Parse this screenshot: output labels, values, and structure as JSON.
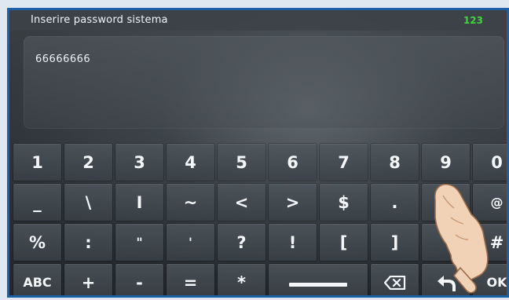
{
  "header": {
    "title": "Inserire password sistema",
    "mode_badge": "123"
  },
  "input": {
    "value": "66666666"
  },
  "keyboard": {
    "row1": [
      "1",
      "2",
      "3",
      "4",
      "5",
      "6",
      "7",
      "8",
      "9",
      "0"
    ],
    "row2": [
      "_",
      "\\",
      "I",
      "~",
      "<",
      ">",
      "$",
      ".",
      "",
      "@"
    ],
    "row3": [
      "%",
      ":",
      "\"",
      "'",
      "?",
      "!",
      "[",
      "]",
      "",
      "#"
    ],
    "row4": {
      "abc_label": "ABC",
      "plus": "+",
      "minus": "-",
      "equals": "=",
      "asterisk": "*",
      "ok_label": "OK"
    }
  },
  "icons": {
    "space": "space-bar-icon",
    "backspace": "backspace-icon",
    "back": "back-arrow-icon",
    "hand": "pointing-hand-icon"
  },
  "colors": {
    "frame_border": "#1f5fa8",
    "mode_badge": "#43d43f",
    "key_text": "#f4f6f8"
  }
}
